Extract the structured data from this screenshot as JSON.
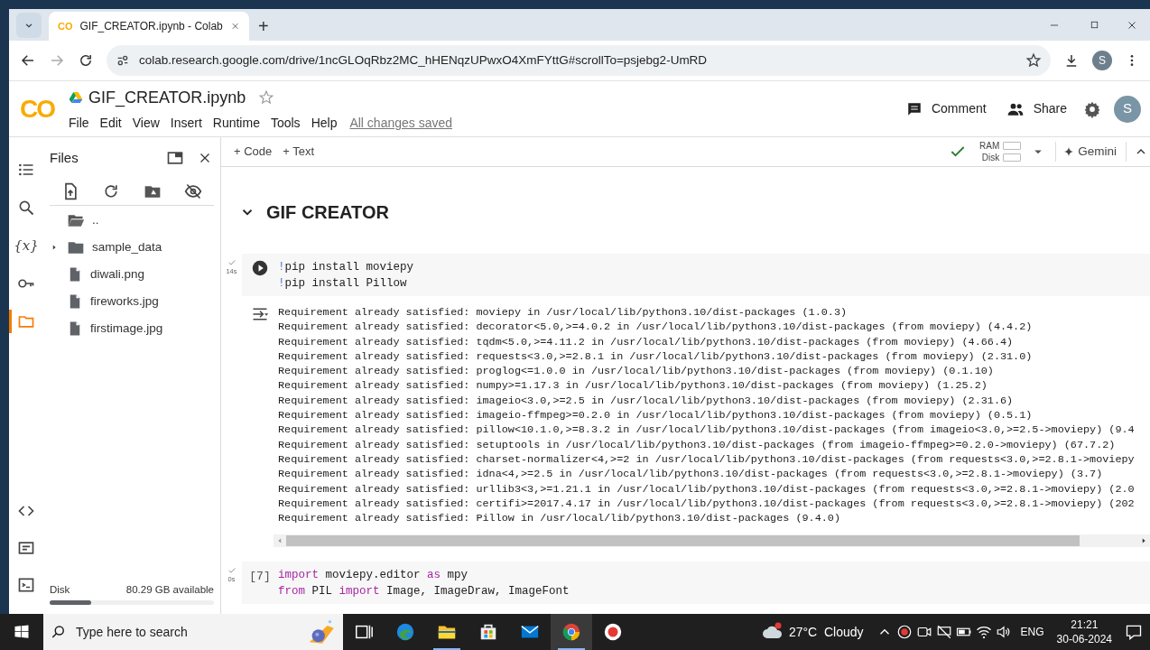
{
  "browser": {
    "tabs": [
      {
        "favicon": "CO",
        "title": "GIF_CREATOR.ipynb - Colab",
        "selected": true
      }
    ],
    "new_tab": "+",
    "url": "colab.research.google.com/drive/1ncGLOqRbz2MC_hHENqzUPwxO4XmFYttG#scrollTo=psjebg2-UmRD",
    "profile": "S"
  },
  "header": {
    "logo": "CO",
    "title": "GIF_CREATOR.ipynb",
    "menu": [
      "File",
      "Edit",
      "View",
      "Insert",
      "Runtime",
      "Tools",
      "Help"
    ],
    "save_status": "All changes saved",
    "comment": "Comment",
    "share": "Share",
    "avatar": "S"
  },
  "rail": [
    {
      "kind": "toc",
      "selected": false
    },
    {
      "kind": "search",
      "selected": false
    },
    {
      "kind": "variables",
      "label": "{x}",
      "selected": false
    },
    {
      "kind": "secrets",
      "selected": false
    },
    {
      "kind": "files",
      "selected": true
    }
  ],
  "rail_bottom": [
    {
      "kind": "snippets"
    },
    {
      "kind": "palette"
    },
    {
      "kind": "terminal"
    }
  ],
  "files": {
    "title": "Files",
    "items": [
      {
        "kind": "parent",
        "name": ".."
      },
      {
        "kind": "folder",
        "name": "sample_data",
        "expanded": false
      },
      {
        "kind": "file",
        "name": "diwali.png"
      },
      {
        "kind": "file",
        "name": "fireworks.jpg"
      },
      {
        "kind": "file",
        "name": "firstimage.jpg"
      }
    ],
    "disk": {
      "label": "Disk",
      "available": "80.29 GB available",
      "level": 0.25
    }
  },
  "toolbar": {
    "add": [
      "+ Code",
      "+ Text"
    ],
    "ram": "RAM",
    "disk": "Disk",
    "gemini": "Gemini"
  },
  "section": {
    "title": "GIF CREATOR",
    "expanded": true
  },
  "cells": [
    {
      "exec_time": "14s",
      "lines": [
        [
          {
            "text": "!",
            "kind": "magic"
          },
          {
            "text": "pip install moviepy",
            "kind": "plain"
          }
        ],
        [
          {
            "text": "!",
            "kind": "magic"
          },
          {
            "text": "pip install Pillow",
            "kind": "plain"
          }
        ]
      ],
      "output": [
        "Requirement already satisfied: moviepy in /usr/local/lib/python3.10/dist-packages (1.0.3)",
        "Requirement already satisfied: decorator<5.0,>=4.0.2 in /usr/local/lib/python3.10/dist-packages (from moviepy) (4.4.2)",
        "Requirement already satisfied: tqdm<5.0,>=4.11.2 in /usr/local/lib/python3.10/dist-packages (from moviepy) (4.66.4)",
        "Requirement already satisfied: requests<3.0,>=2.8.1 in /usr/local/lib/python3.10/dist-packages (from moviepy) (2.31.0)",
        "Requirement already satisfied: proglog<=1.0.0 in /usr/local/lib/python3.10/dist-packages (from moviepy) (0.1.10)",
        "Requirement already satisfied: numpy>=1.17.3 in /usr/local/lib/python3.10/dist-packages (from moviepy) (1.25.2)",
        "Requirement already satisfied: imageio<3.0,>=2.5 in /usr/local/lib/python3.10/dist-packages (from moviepy) (2.31.6)",
        "Requirement already satisfied: imageio-ffmpeg>=0.2.0 in /usr/local/lib/python3.10/dist-packages (from moviepy) (0.5.1)",
        "Requirement already satisfied: pillow<10.1.0,>=8.3.2 in /usr/local/lib/python3.10/dist-packages (from imageio<3.0,>=2.5->moviepy) (9.4",
        "Requirement already satisfied: setuptools in /usr/local/lib/python3.10/dist-packages (from imageio-ffmpeg>=0.2.0->moviepy) (67.7.2)",
        "Requirement already satisfied: charset-normalizer<4,>=2 in /usr/local/lib/python3.10/dist-packages (from requests<3.0,>=2.8.1->moviepy",
        "Requirement already satisfied: idna<4,>=2.5 in /usr/local/lib/python3.10/dist-packages (from requests<3.0,>=2.8.1->moviepy) (3.7)",
        "Requirement already satisfied: urllib3<3,>=1.21.1 in /usr/local/lib/python3.10/dist-packages (from requests<3.0,>=2.8.1->moviepy) (2.0",
        "Requirement already satisfied: certifi>=2017.4.17 in /usr/local/lib/python3.10/dist-packages (from requests<3.0,>=2.8.1->moviepy) (202",
        "Requirement already satisfied: Pillow in /usr/local/lib/python3.10/dist-packages (9.4.0)"
      ]
    },
    {
      "exec_time": "0s",
      "exec_count": "[7]",
      "lines": [
        [
          {
            "text": "import",
            "kind": "keyword"
          },
          {
            "text": " moviepy.editor ",
            "kind": "plain"
          },
          {
            "text": "as",
            "kind": "keyword"
          },
          {
            "text": " mpy",
            "kind": "plain"
          }
        ],
        [
          {
            "text": "from",
            "kind": "keyword"
          },
          {
            "text": " PIL ",
            "kind": "plain"
          },
          {
            "text": "import",
            "kind": "keyword"
          },
          {
            "text": " Image, ImageDraw, ImageFont",
            "kind": "plain"
          }
        ]
      ]
    }
  ],
  "taskbar": {
    "search_placeholder": "Type here to search",
    "apps": [
      {
        "kind": "taskview",
        "running": false
      },
      {
        "kind": "edge",
        "running": false
      },
      {
        "kind": "explorer",
        "running": true
      },
      {
        "kind": "store",
        "running": false
      },
      {
        "kind": "mail",
        "running": false
      },
      {
        "kind": "chrome",
        "running": true,
        "selected": true
      },
      {
        "kind": "recorder",
        "running": false
      }
    ],
    "weather": "27°C  Cloudy",
    "language": "ENG",
    "time": "21:21",
    "date": "30-06-2024"
  }
}
